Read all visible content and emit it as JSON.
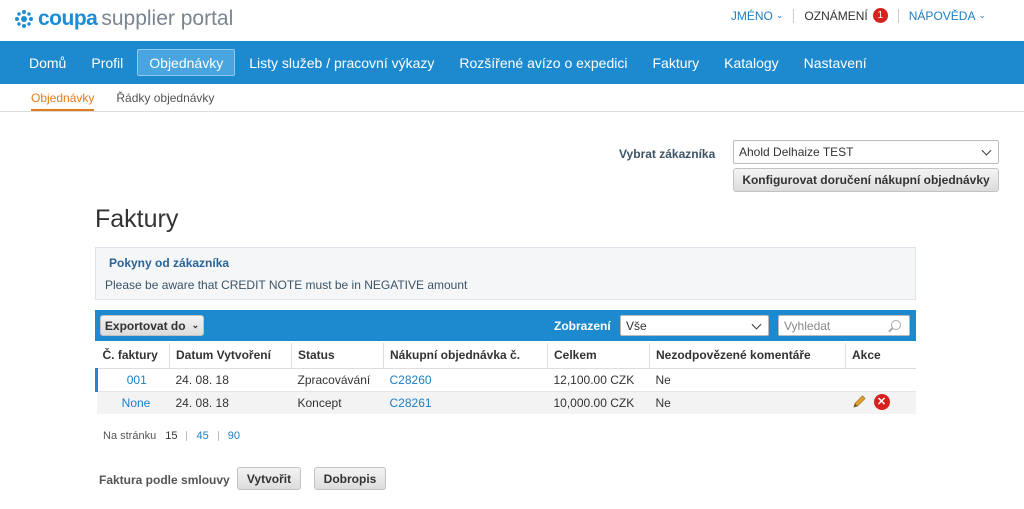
{
  "header": {
    "brand": "coupa",
    "portal": "supplier portal",
    "name_link": "JMÉNO",
    "notifications_label": "OZNÁMENÍ",
    "notifications_count": "1",
    "help_link": "NÁPOVĚDA"
  },
  "nav": {
    "items": [
      "Domů",
      "Profil",
      "Objednávky",
      "Listy služeb / pracovní výkazy",
      "Rozšířené avízo o expedici",
      "Faktury",
      "Katalogy",
      "Nastavení"
    ],
    "active": "Objednávky"
  },
  "subnav": {
    "items": [
      "Objednávky",
      "Řádky objednávky"
    ],
    "active": "Objednávky"
  },
  "customer": {
    "label": "Vybrat zákazníka",
    "selected": "Ahold Delhaize TEST",
    "configure_button": "Konfigurovat doručení nákupní objednávky"
  },
  "page_title": "Faktury",
  "notice": {
    "heading": "Pokyny od zákazníka",
    "text": "Please be aware that CREDIT NOTE must be in NEGATIVE amount"
  },
  "toolbar": {
    "export_label": "Exportovat do",
    "view_label": "Zobrazení",
    "view_selected": "Vše",
    "search_placeholder": "Vyhledat"
  },
  "table": {
    "columns": [
      "Č. faktury",
      "Datum Vytvoření",
      "Status",
      "Nákupní objednávka č.",
      "Celkem",
      "Nezodpovězené komentáře",
      "Akce"
    ],
    "rows": [
      {
        "invoice": "001",
        "date": "24. 08. 18",
        "status": "Zpracovávání",
        "po": "C28260",
        "total": "12,100.00 CZK",
        "comments": "Ne"
      },
      {
        "invoice": "None",
        "date": "24. 08. 18",
        "status": "Koncept",
        "po": "C28261",
        "total": "10,000.00 CZK",
        "comments": "Ne"
      }
    ]
  },
  "pager": {
    "label": "Na stránku",
    "options": [
      "15",
      "45",
      "90"
    ],
    "current": "15"
  },
  "contract": {
    "label": "Faktura podle smlouvy",
    "create_button": "Vytvořit",
    "credit_button": "Dobropis"
  },
  "colors": {
    "nav_blue": "#1d8ad0",
    "link_blue": "#1d7fc5",
    "accent_orange": "#e27b1b",
    "badge_red": "#d9211f"
  },
  "icons": [
    "coupa-logo-icon",
    "chevron-down-icon",
    "search-icon",
    "edit-pencil-icon",
    "delete-icon"
  ]
}
